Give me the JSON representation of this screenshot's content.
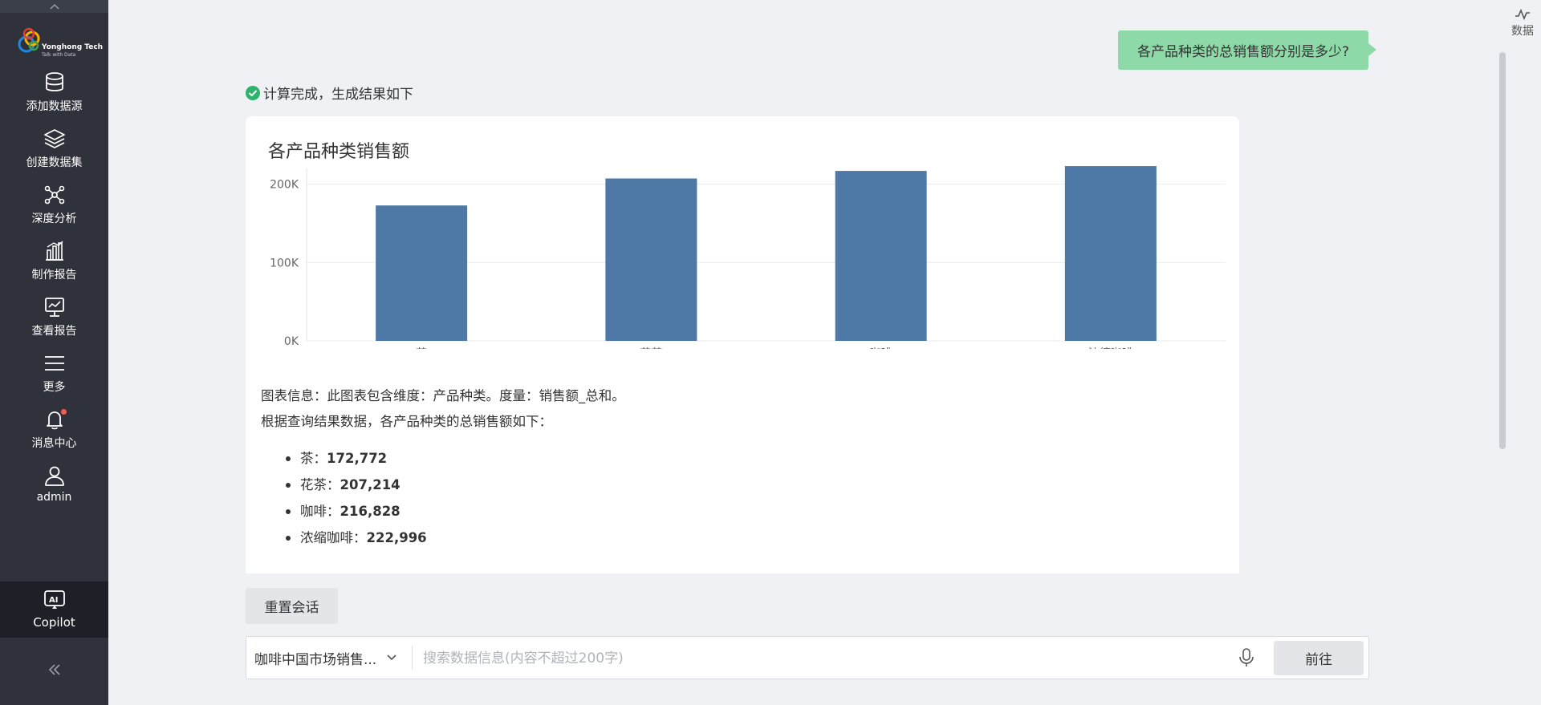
{
  "sidebar": {
    "logo": {
      "text": "Yonghong Tech",
      "sub": "Talk with Data"
    },
    "items": [
      {
        "label": "添加数据源",
        "icon": "database-icon"
      },
      {
        "label": "创建数据集",
        "icon": "layers-icon"
      },
      {
        "label": "深度分析",
        "icon": "network-icon"
      },
      {
        "label": "制作报告",
        "icon": "bar-chart-icon"
      },
      {
        "label": "查看报告",
        "icon": "monitor-chart-icon"
      },
      {
        "label": "更多",
        "icon": "menu-icon"
      },
      {
        "label": "消息中心",
        "icon": "bell-icon"
      },
      {
        "label": "admin",
        "icon": "user-icon"
      }
    ],
    "copilot": {
      "label": "Copilot",
      "icon": "ai-icon"
    }
  },
  "rail": {
    "data_label": "数据",
    "icon": "pulse-icon"
  },
  "chat": {
    "question": "各产品种类的总销售额分别是多少?",
    "status": "计算完成，生成结果如下"
  },
  "chart_data": {
    "type": "bar",
    "title": "各产品种类销售额",
    "categories": [
      "茶",
      "花茶",
      "咖啡",
      "浓缩咖啡"
    ],
    "values": [
      172773,
      207214,
      216828,
      222996
    ],
    "ylim": [
      0,
      220000
    ],
    "yticks": [
      "0K",
      "100K",
      "200K"
    ],
    "bar_color": "#4e79a7",
    "grid": true
  },
  "answer": {
    "info": "图表信息：此图表包含维度：产品种类。度量：销售额_总和。",
    "intro": "根据查询结果数据，各产品种类的总销售额如下：",
    "items": [
      {
        "name": "茶：",
        "value": "172,772"
      },
      {
        "name": "花茶：",
        "value": "207,214"
      },
      {
        "name": "咖啡：",
        "value": "216,828"
      },
      {
        "name": "浓缩咖啡：",
        "value": "222,996"
      }
    ]
  },
  "controls": {
    "reset_label": "重置会话",
    "dataset_label": "咖啡中国市场销售...",
    "search_placeholder": "搜索数据信息(内容不超过200字)",
    "go_label": "前往"
  }
}
